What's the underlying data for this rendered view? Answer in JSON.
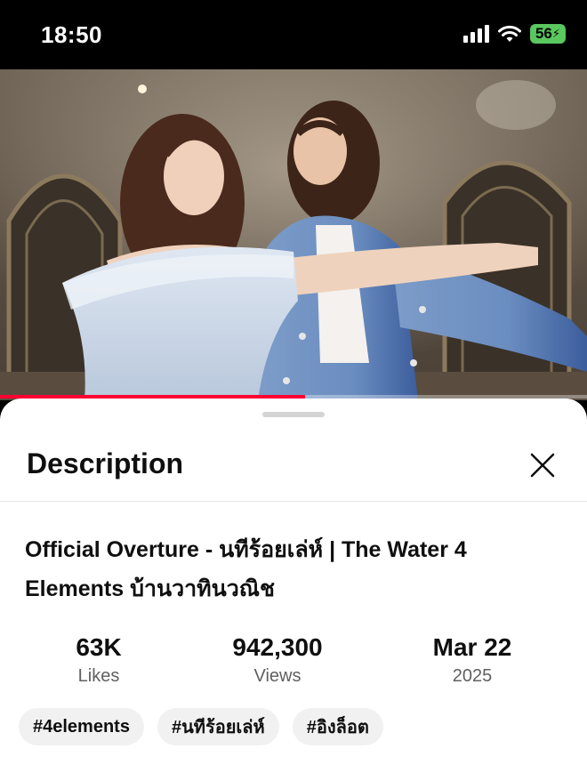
{
  "status_bar": {
    "time": "18:50",
    "battery": "56",
    "icons": [
      "cellular-signal-icon",
      "wifi-icon",
      "battery-charging-icon"
    ]
  },
  "video": {
    "progress_fraction": 0.52,
    "progress_color": "#ff0033"
  },
  "description_panel": {
    "title": "Description",
    "close_icon": "close-icon",
    "video_title": "Official Overture - นทีร้อยเล่ห์ | The Water 4 Elements บ้านวาทินวณิช",
    "stats": [
      {
        "value": "63K",
        "label": "Likes"
      },
      {
        "value": "942,300",
        "label": "Views"
      },
      {
        "value": "Mar 22",
        "label": "2025"
      }
    ],
    "hashtags": [
      "#4elements",
      "#นทีร้อยเล่ห์",
      "#อิงล็อต"
    ]
  }
}
